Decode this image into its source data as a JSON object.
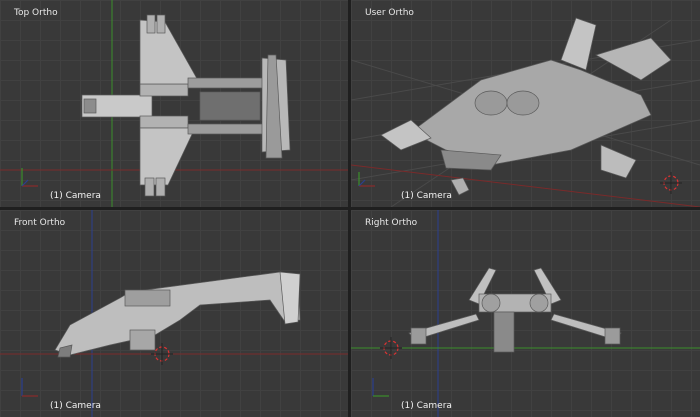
{
  "viewports": {
    "top": {
      "title": "Top Ortho",
      "camera_label": "(1) Camera"
    },
    "user": {
      "title": "User Ortho",
      "camera_label": "(1) Camera"
    },
    "front": {
      "title": "Front Ortho",
      "camera_label": "(1) Camera"
    },
    "right": {
      "title": "Right Ortho",
      "camera_label": "(1) Camera"
    }
  },
  "colors": {
    "viewport_bg": "#393939",
    "grid_line": "#414141",
    "separator": "#1f1f1f",
    "axis_x": "#8a2a2a",
    "axis_y": "#3c8f2c",
    "axis_z": "#2b3f8f",
    "model_light": "#d0d0d0",
    "model_mid": "#a6a6a6",
    "model_dark": "#6c6c6c"
  },
  "icons": {
    "axis_gizmo": "axis-gizmo-icon",
    "cursor": "3d-cursor-icon"
  }
}
